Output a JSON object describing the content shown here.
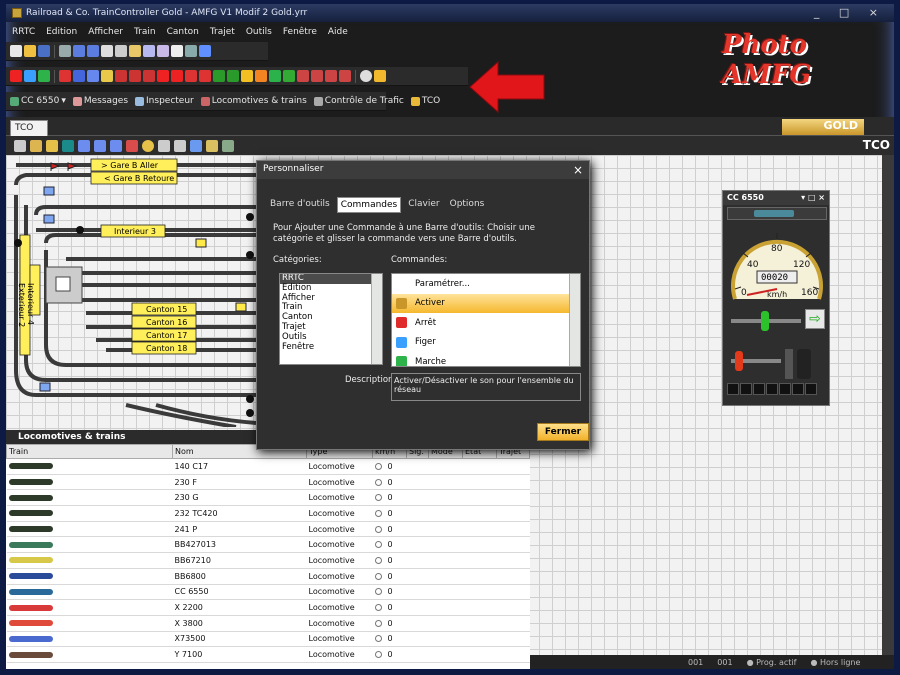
{
  "window": {
    "title": "Railroad & Co. TrainController Gold - AMFG V1 Modif 2 Gold.yrr",
    "controls": "_ □ ×"
  },
  "menu": [
    "RRTC",
    "Edition",
    "Afficher",
    "Train",
    "Canton",
    "Trajet",
    "Outils",
    "Fenêtre",
    "Aide"
  ],
  "logo": {
    "text": "Photo AMFG"
  },
  "toolbar3": {
    "loco_select": "CC 6550",
    "items": [
      "Messages",
      "Inspecteur",
      "Locomotives & trains",
      "Contrôle de Trafic",
      "TCO"
    ]
  },
  "tabs": {
    "tco": "TCO",
    "gold": "GOLD",
    "tco_right": "TCO"
  },
  "track_labels": {
    "gare_aller": "> Gare B Aller",
    "gare_retour": "< Gare B  Retoure",
    "interieur3": "Interieur 3",
    "canton15": "Canton 15",
    "canton16": "Canton 16",
    "canton17": "Canton 17",
    "canton18": "Canton 18",
    "vertical1": "Interieur 4",
    "vertical2": "Exterieur 2"
  },
  "dialog": {
    "title": "Personnaliser",
    "tabs": [
      "Barre d'outils",
      "Commandes",
      "Clavier",
      "Options"
    ],
    "info": "Pour Ajouter une Commande à une Barre d'outils: Choisir une catégorie et glisser la commande vers une Barre d'outils.",
    "categories_label": "Catégories:",
    "commands_label": "Commandes:",
    "categories": [
      "RRTC",
      "Edition",
      "Afficher",
      "Train",
      "Canton",
      "Trajet",
      "Outils",
      "Fenêtre"
    ],
    "commands": [
      "Paramétrer...",
      "Activer",
      "Arrêt",
      "Figer",
      "Marche"
    ],
    "description_label": "Description:",
    "description": "Activer/Désactiver le son pour l'ensemble du réseau",
    "close_button": "Fermer"
  },
  "loco_panel": {
    "title": "Locomotives & trains",
    "columns": [
      "Train",
      "Nom",
      "Type",
      "km/h",
      "Sig.",
      "Mode",
      "Etat",
      "Trajet"
    ],
    "rows": [
      [
        "140 C17",
        "Locomotive",
        "0"
      ],
      [
        "230 F",
        "Locomotive",
        "0"
      ],
      [
        "230 G",
        "Locomotive",
        "0"
      ],
      [
        "232 TC420",
        "Locomotive",
        "0"
      ],
      [
        "241 P",
        "Locomotive",
        "0"
      ],
      [
        "BB427013",
        "Locomotive",
        "0"
      ],
      [
        "BB67210",
        "Locomotive",
        "0"
      ],
      [
        "BB6800",
        "Locomotive",
        "0"
      ],
      [
        "CC 6550",
        "Locomotive",
        "0"
      ],
      [
        "X 2200",
        "Locomotive",
        "0"
      ],
      [
        "X 3800",
        "Locomotive",
        "0"
      ],
      [
        "X73500",
        "Locomotive",
        "0"
      ],
      [
        "Y 7100",
        "Locomotive",
        "0"
      ]
    ]
  },
  "throttle": {
    "title": "CC 6550",
    "speed_display": "00020",
    "unit": "km/h",
    "ticks": [
      "0",
      "40",
      "80",
      "120",
      "160"
    ]
  },
  "status": [
    "001",
    "001",
    "Prog. actif",
    "Hors ligne"
  ],
  "colors": {
    "accent_gold": "#f5b82e",
    "arrow_red": "#e0161b"
  }
}
